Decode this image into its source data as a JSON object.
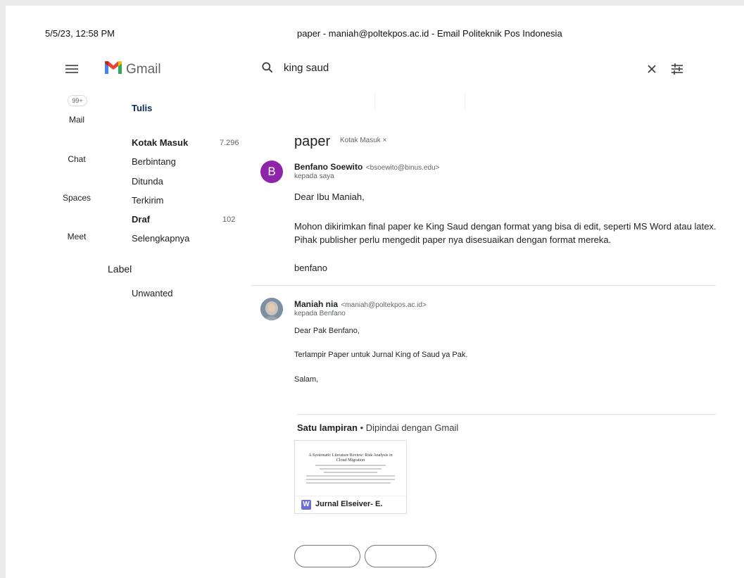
{
  "print_header": {
    "datetime": "5/5/23, 12:58 PM",
    "page_title": "paper - maniah@poltekpos.ac.id - Email Politeknik Pos Indonesia"
  },
  "app": {
    "name": "Gmail",
    "icons": {
      "menu": "hamburger-menu-icon",
      "logo": "gmail-m-logo",
      "search": "search-icon",
      "clear": "close-icon",
      "filters": "tune-icon"
    }
  },
  "search": {
    "value": "king saud"
  },
  "rail": {
    "badge": "99+",
    "items": [
      "Mail",
      "Chat",
      "Spaces",
      "Meet"
    ]
  },
  "nav": {
    "compose": "Tulis",
    "folders": [
      {
        "label": "Kotak Masuk",
        "count": "7.296",
        "bold": true
      },
      {
        "label": "Berbintang",
        "count": "",
        "bold": false
      },
      {
        "label": "Ditunda",
        "count": "",
        "bold": false
      },
      {
        "label": "Terkirim",
        "count": "",
        "bold": false
      },
      {
        "label": "Draf",
        "count": "102",
        "bold": true
      },
      {
        "label": "Selengkapnya",
        "count": "",
        "bold": false
      }
    ],
    "labels_heading": "Label",
    "labels": [
      "Unwanted"
    ]
  },
  "thread": {
    "subject": "paper",
    "label_chip": "Kotak Masuk ×",
    "messages": [
      {
        "avatar_letter": "B",
        "avatar_color": "#8e24aa",
        "sender_name": "Benfano Soewito",
        "sender_email": "<bsoewito@binus.edu>",
        "to": "kepada saya",
        "lines": [
          "Dear Ibu Maniah,",
          "Mohon dikirimkan final paper ke King Saud dengan format yang bisa di edit, seperti MS Word atau latex.",
          "Pihak publisher perlu mengedit paper nya disesuaikan dengan format mereka.",
          "benfano"
        ]
      },
      {
        "avatar_letter": "",
        "sender_name": "Maniah nia",
        "sender_email": "<maniah@poltekpos.ac.id>",
        "to": "kepada Benfano",
        "lines": [
          "Dear Pak Benfano,",
          "Terlampir Paper untuk Jurnal King of Saud ya Pak.",
          "Salam,"
        ]
      }
    ],
    "attachments_heading": "Satu lampiran",
    "attachments_note": " •  Dipindai dengan Gmail",
    "attachment": {
      "preview_title": "A Systematic Literature Review: Risk Analysis in Cloud Migration",
      "type_badge": "W",
      "type_color": "#6a6fd1",
      "name": "Jurnal Elseiver- E."
    }
  }
}
